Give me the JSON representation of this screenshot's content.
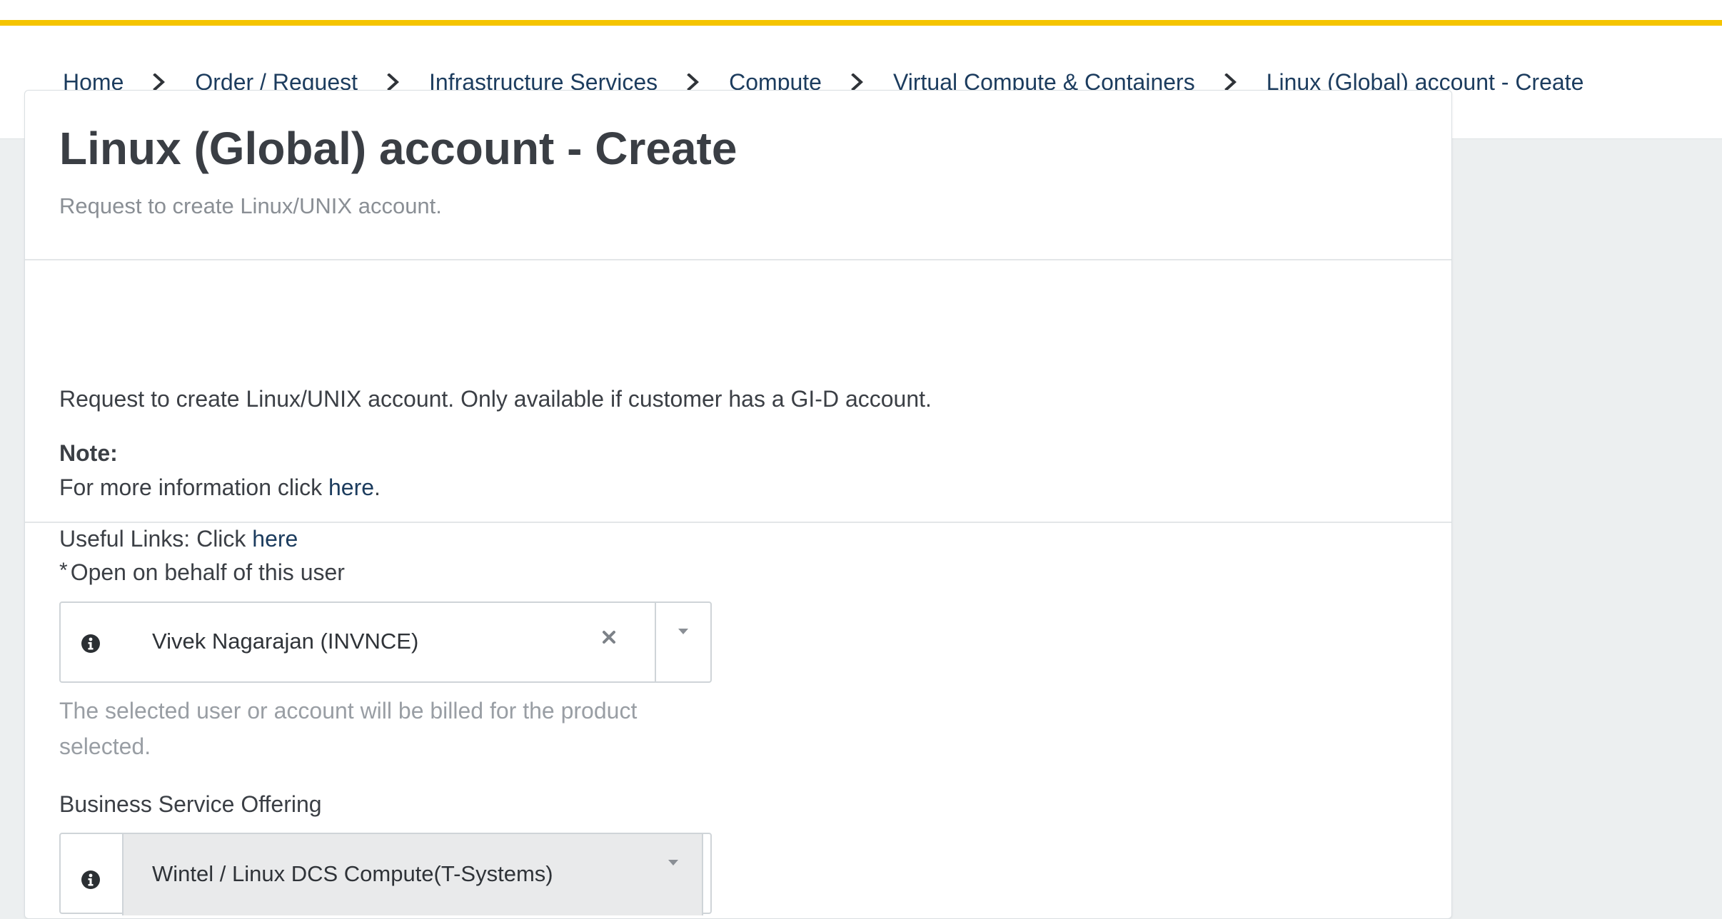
{
  "breadcrumb": {
    "items": [
      "Home",
      "Order / Request",
      "Infrastructure Services",
      "Compute",
      "Virtual Compute & Containers",
      "Linux (Global) account - Create"
    ]
  },
  "header": {
    "title": "Linux (Global) account - Create",
    "subtitle": "Request to create Linux/UNIX account."
  },
  "description": {
    "text": "Request to create Linux/UNIX account. Only available if customer has a GI-D account.",
    "note_label": "Note:",
    "info_prefix": "For more information click ",
    "info_link": "here",
    "info_suffix": ".",
    "links_prefix": "Useful Links: Click ",
    "links_link": "here"
  },
  "form": {
    "behalf": {
      "required_mark": "*",
      "label": "Open on behalf of this user",
      "value": "Vivek Nagarajan (INVNCE)",
      "help": "The selected user or account will be billed for the product selected."
    },
    "business_service": {
      "label": "Business Service Offering",
      "value": "Wintel / Linux DCS Compute(T-Systems)"
    }
  },
  "colors": {
    "accent": "#f5c400",
    "link": "#1c3c5e",
    "text": "#3b3f45",
    "muted": "#999ea4"
  },
  "icons": [
    "chevron-right-icon",
    "info-icon",
    "close-icon",
    "caret-down-icon"
  ]
}
